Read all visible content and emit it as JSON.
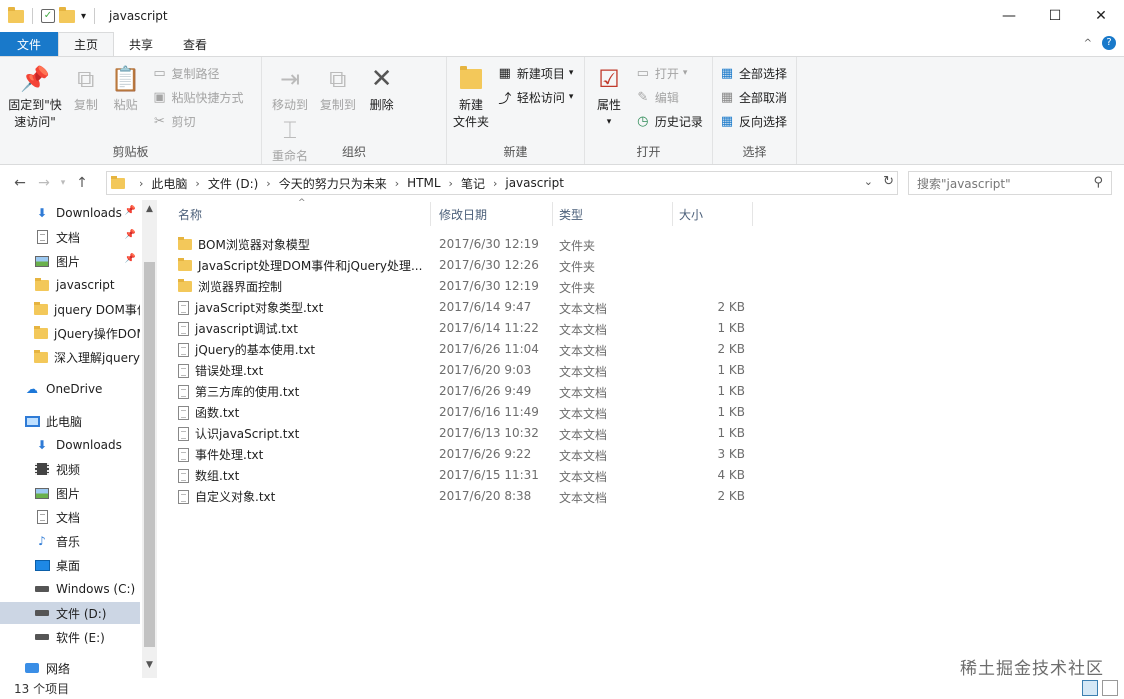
{
  "window": {
    "title": "javascript",
    "controls": {
      "minimize": "—",
      "maximize": "☐",
      "close": "✕"
    }
  },
  "ribbon_tabs": [
    "文件",
    "主页",
    "共享",
    "查看"
  ],
  "ribbon": {
    "clipboard": {
      "label": "剪贴板",
      "pin_label": "固定到\"快\n速访问\"",
      "copy": "复制",
      "paste": "粘贴",
      "copy_path": "复制路径",
      "paste_shortcut": "粘贴快捷方式",
      "cut": "剪切"
    },
    "organize": {
      "label": "组织",
      "move_to": "移动到",
      "copy_to": "复制到",
      "delete": "删除",
      "rename": "重命名"
    },
    "new": {
      "label": "新建",
      "new_folder": "新建\n文件夹",
      "new_item": "新建项目",
      "easy_access": "轻松访问"
    },
    "open": {
      "label": "打开",
      "properties": "属性",
      "open": "打开",
      "edit": "编辑",
      "history": "历史记录"
    },
    "select": {
      "label": "选择",
      "select_all": "全部选择",
      "select_none": "全部取消",
      "invert": "反向选择"
    }
  },
  "address": {
    "crumbs": [
      "此电脑",
      "文件 (D:)",
      "今天的努力只为未来",
      "HTML",
      "笔记",
      "javascript"
    ],
    "search_placeholder": "搜索\"javascript\""
  },
  "nav_pane": [
    {
      "label": "Downloads",
      "icon": "download-icon",
      "pinned": true
    },
    {
      "label": "文档",
      "icon": "document-icon",
      "pinned": true
    },
    {
      "label": "图片",
      "icon": "pictures-icon",
      "pinned": true
    },
    {
      "label": "javascript",
      "icon": "folder-icon"
    },
    {
      "label": "jquery DOM事件",
      "icon": "folder-icon"
    },
    {
      "label": "jQuery操作DOM",
      "icon": "folder-icon"
    },
    {
      "label": "深入理解jquery",
      "icon": "folder-icon"
    },
    {
      "label": "OneDrive",
      "icon": "cloud-icon"
    },
    {
      "label": "此电脑",
      "icon": "computer-icon"
    },
    {
      "label": "Downloads",
      "icon": "download-icon"
    },
    {
      "label": "视频",
      "icon": "video-icon"
    },
    {
      "label": "图片",
      "icon": "pictures-icon"
    },
    {
      "label": "文档",
      "icon": "document-icon"
    },
    {
      "label": "音乐",
      "icon": "music-icon"
    },
    {
      "label": "桌面",
      "icon": "desktop-icon"
    },
    {
      "label": "Windows (C:)",
      "icon": "drive-icon"
    },
    {
      "label": "文件 (D:)",
      "icon": "drive-icon",
      "selected": true
    },
    {
      "label": "软件 (E:)",
      "icon": "drive-icon"
    },
    {
      "label": "网络",
      "icon": "network-icon"
    }
  ],
  "columns": {
    "name": "名称",
    "date": "修改日期",
    "type": "类型",
    "size": "大小"
  },
  "files": [
    {
      "name": "BOM浏览器对象模型",
      "date": "2017/6/30 12:19",
      "type": "文件夹",
      "size": "",
      "kind": "folder"
    },
    {
      "name": "JavaScript处理DOM事件和jQuery处理...",
      "date": "2017/6/30 12:26",
      "type": "文件夹",
      "size": "",
      "kind": "folder"
    },
    {
      "name": "浏览器界面控制",
      "date": "2017/6/30 12:19",
      "type": "文件夹",
      "size": "",
      "kind": "folder"
    },
    {
      "name": "javaScript对象类型.txt",
      "date": "2017/6/14 9:47",
      "type": "文本文档",
      "size": "2 KB",
      "kind": "txt"
    },
    {
      "name": "javascript调试.txt",
      "date": "2017/6/14 11:22",
      "type": "文本文档",
      "size": "1 KB",
      "kind": "txt"
    },
    {
      "name": "jQuery的基本使用.txt",
      "date": "2017/6/26 11:04",
      "type": "文本文档",
      "size": "2 KB",
      "kind": "txt"
    },
    {
      "name": "错误处理.txt",
      "date": "2017/6/20 9:03",
      "type": "文本文档",
      "size": "1 KB",
      "kind": "txt"
    },
    {
      "name": "第三方库的使用.txt",
      "date": "2017/6/26 9:49",
      "type": "文本文档",
      "size": "1 KB",
      "kind": "txt"
    },
    {
      "name": "函数.txt",
      "date": "2017/6/16 11:49",
      "type": "文本文档",
      "size": "1 KB",
      "kind": "txt"
    },
    {
      "name": "认识javaScript.txt",
      "date": "2017/6/13 10:32",
      "type": "文本文档",
      "size": "1 KB",
      "kind": "txt"
    },
    {
      "name": "事件处理.txt",
      "date": "2017/6/26 9:22",
      "type": "文本文档",
      "size": "3 KB",
      "kind": "txt"
    },
    {
      "name": "数组.txt",
      "date": "2017/6/15 11:31",
      "type": "文本文档",
      "size": "4 KB",
      "kind": "txt"
    },
    {
      "name": "自定义对象.txt",
      "date": "2017/6/20 8:38",
      "type": "文本文档",
      "size": "2 KB",
      "kind": "txt"
    }
  ],
  "status": {
    "count": "13 个项目"
  },
  "watermark": "稀土掘金技术社区",
  "colors": {
    "accent": "#1979ca",
    "selected": "#ccd6e4",
    "folder": "#f3c85a"
  }
}
